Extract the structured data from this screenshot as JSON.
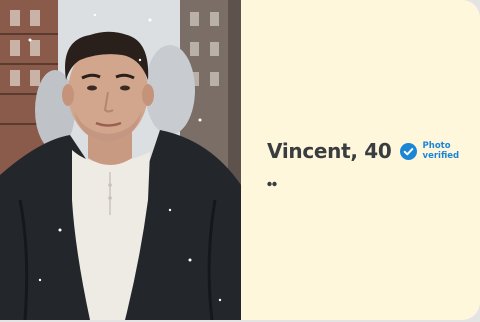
{
  "profile": {
    "name_age": "Vincent, 40",
    "verified_label": "Photo verified",
    "photo_alt": "profile-photo"
  },
  "icons": {
    "verified": "verified-check-icon",
    "quote": "quote-icon"
  },
  "colors": {
    "card_background": "#fff7dc",
    "verified_blue": "#1c86d6",
    "name_text": "#3a3d3f"
  }
}
